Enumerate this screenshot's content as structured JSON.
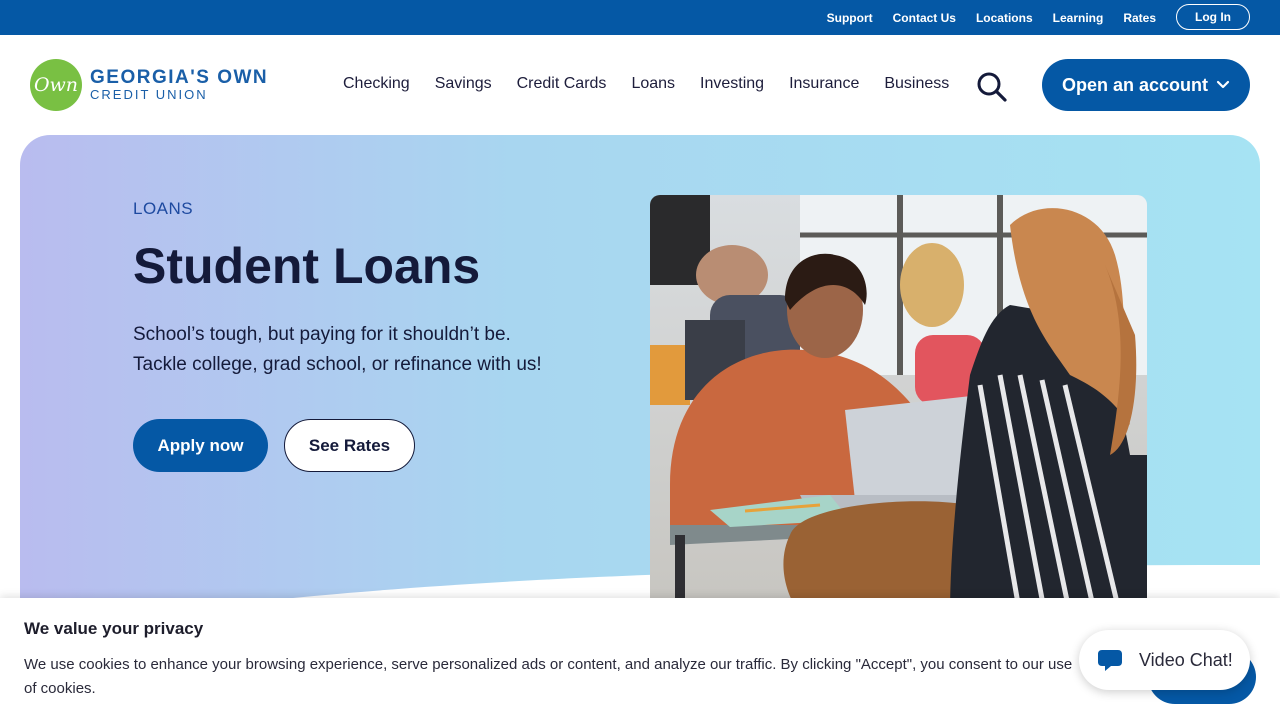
{
  "utility": {
    "links": [
      "Support",
      "Contact Us",
      "Locations",
      "Learning",
      "Rates"
    ],
    "login": "Log In"
  },
  "logo": {
    "mark": "Own",
    "line1": "GEORGIA'S OWN",
    "line2": "CREDIT UNION"
  },
  "nav": {
    "items": [
      "Checking",
      "Savings",
      "Credit Cards",
      "Loans",
      "Investing",
      "Insurance",
      "Business"
    ],
    "open_account": "Open an account"
  },
  "hero": {
    "eyebrow": "LOANS",
    "title": "Student Loans",
    "subtitle_line1": "School’s tough, but paying for it shouldn’t be.",
    "subtitle_line2": "Tackle college, grad school, or refinance with us!",
    "apply": "Apply now",
    "see_rates": "See Rates"
  },
  "cookie": {
    "title": "We value your privacy",
    "text": "We use cookies to enhance your browsing experience, serve personalized ads or content, and analyze our traffic. By clicking \"Accept\", you consent to our use of cookies."
  },
  "chat": {
    "label": "Video Chat!"
  },
  "colors": {
    "brand_blue": "#0558a5",
    "logo_green": "#79c043",
    "text_dark": "#141a3a"
  }
}
